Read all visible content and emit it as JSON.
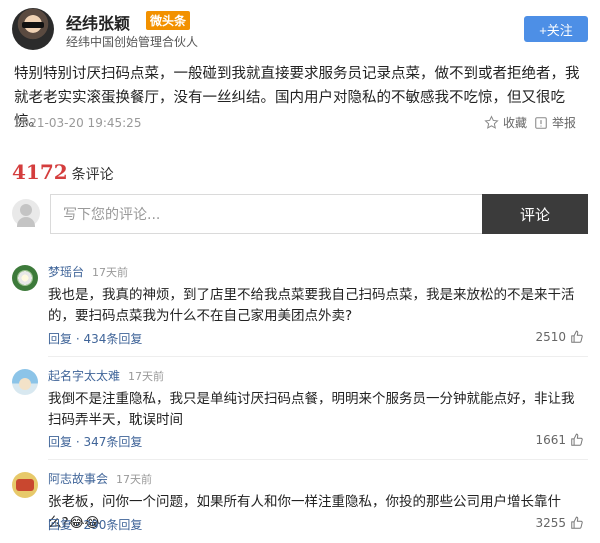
{
  "author": {
    "name": "经纬张颖",
    "badge": "微头条",
    "description": "经纬中国创始管理合伙人",
    "follow_label": "+关注"
  },
  "post": {
    "text": "特别特别讨厌扫码点菜，一般碰到我就直接要求服务员记录点菜，做不到或者拒绝者，我就老老实实滚蛋换餐厅，没有一丝纠结。国内用户对隐私的不敏感我不吃惊，但又很吃惊。",
    "date": "2021-03-20 19:45:25",
    "favorite_label": "收藏",
    "report_label": "举报"
  },
  "comments_header": {
    "count": "4172",
    "label": "条评论"
  },
  "comment_input": {
    "placeholder": "写下您的评论...",
    "submit_label": "评论"
  },
  "comments": [
    {
      "user": "梦瑶台",
      "time": "17天前",
      "text": "我也是，我真的神烦，到了店里不给我点菜要我自己扫码点菜，我是来放松的不是来干活的，要扫码点菜我为什么不在自己家用美团点外卖?",
      "reply_label": "回复",
      "reply_count": "434条回复",
      "likes": "2510"
    },
    {
      "user": "起名字太太难",
      "time": "17天前",
      "text": "我倒不是注重隐私，我只是单纯讨厌扫码点餐，明明来个服务员一分钟就能点好，非让我扫码弄半天，耽误时间",
      "reply_label": "回复",
      "reply_count": "347条回复",
      "likes": "1661"
    },
    {
      "user": "阿志故事会",
      "time": "17天前",
      "text": "张老板，问你一个问题，如果所有人和你一样注重隐私，你投的那些公司用户增长靠什么?",
      "emoji": "😂😂",
      "reply_label": "回复",
      "reply_count": "290条回复",
      "likes": "3255"
    }
  ],
  "colors": {
    "accent_blue": "#4d8fe6",
    "count_red": "#d43d3d",
    "link_blue": "#406599",
    "badge_orange": "#f29100"
  }
}
